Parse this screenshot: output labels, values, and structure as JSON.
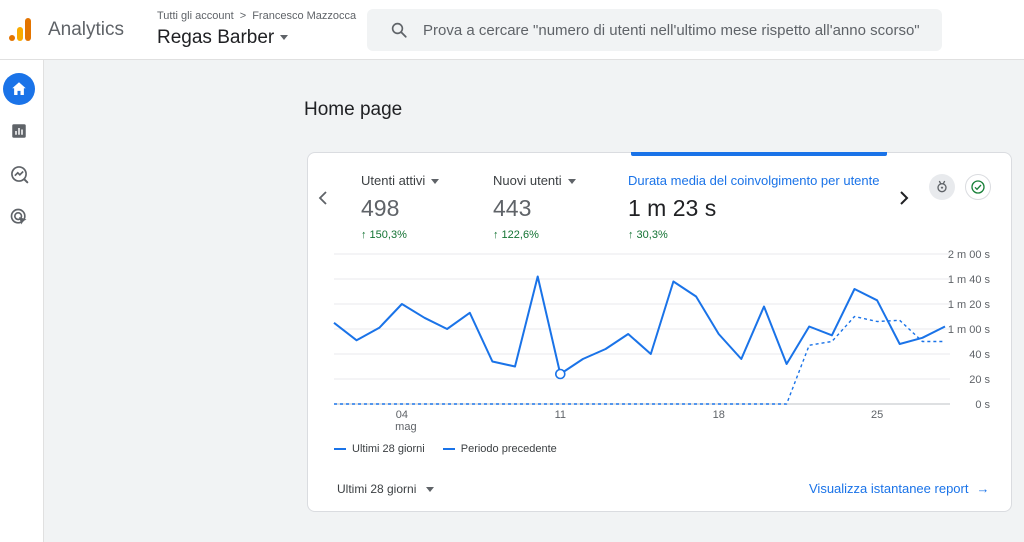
{
  "header": {
    "app_name": "Analytics",
    "breadcrumb": {
      "account": "Tutti gli account",
      "separator": ">",
      "user": "Francesco Mazzocca"
    },
    "property": "Regas Barber",
    "search_placeholder": "Prova a cercare \"numero di utenti nell'ultimo mese rispetto all'anno scorso\""
  },
  "sidebar": {
    "items": [
      {
        "name": "home-icon",
        "active": true
      },
      {
        "name": "reports-icon",
        "active": false
      },
      {
        "name": "explore-icon",
        "active": false
      },
      {
        "name": "advertising-icon",
        "active": false
      }
    ]
  },
  "main": {
    "title": "Home page",
    "metrics": [
      {
        "label": "Utenti attivi",
        "value": "498",
        "change": "↑ 150,3%"
      },
      {
        "label": "Nuovi utenti",
        "value": "443",
        "change": "↑ 122,6%"
      },
      {
        "label": "Durata media del coinvolgimento per utente",
        "value": "1 m 23 s",
        "change": "↑ 30,3%"
      }
    ],
    "legend": {
      "current": "Ultimi 28 giorni",
      "previous": "Periodo precedente"
    },
    "date_range": "Ultimi 28 giorni",
    "report_link": "Visualizza istantanee report",
    "report_arrow": "→"
  },
  "colors": {
    "accent": "#1a73e8",
    "positive": "#137333",
    "grid": "#e8eaed"
  },
  "chart_data": {
    "type": "line",
    "x_ticks": [
      {
        "index": 3,
        "label": "04",
        "sublabel": "mag"
      },
      {
        "index": 10,
        "label": "11"
      },
      {
        "index": 17,
        "label": "18"
      },
      {
        "index": 24,
        "label": "25"
      }
    ],
    "y_ticks": [
      "0 s",
      "20 s",
      "40 s",
      "1 m 00 s",
      "1 m 20 s",
      "1 m 40 s",
      "2 m 00 s"
    ],
    "ylim": [
      0,
      120
    ],
    "grid": true,
    "highlight_index": 10,
    "series": [
      {
        "name": "Ultimi 28 giorni",
        "style": "solid",
        "values": [
          65,
          51,
          61,
          80,
          69,
          60,
          73,
          34,
          30,
          102,
          24,
          36,
          44,
          56,
          40,
          98,
          86,
          56,
          36,
          78,
          32,
          62,
          55,
          92,
          83,
          48,
          53,
          62
        ]
      },
      {
        "name": "Periodo precedente",
        "style": "dashed",
        "values": [
          0,
          0,
          0,
          0,
          0,
          0,
          0,
          0,
          0,
          0,
          0,
          0,
          0,
          0,
          0,
          0,
          0,
          0,
          0,
          0,
          0,
          47,
          50,
          70,
          66,
          67,
          50,
          50
        ]
      }
    ]
  }
}
